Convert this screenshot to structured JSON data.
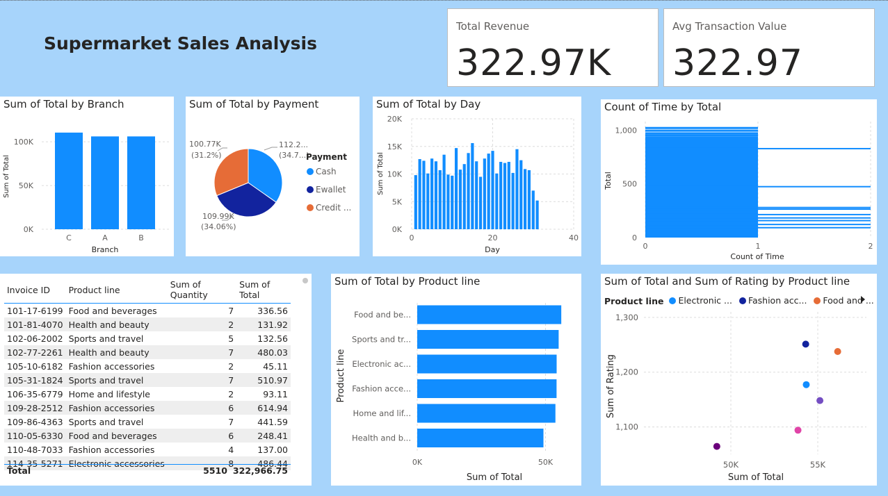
{
  "page": {
    "title": "Supermarket Sales Analysis"
  },
  "cards": [
    {
      "label": "Total Revenue",
      "value": "322.97K"
    },
    {
      "label": "Avg Transaction Value",
      "value": "322.97"
    }
  ],
  "colors": {
    "primary": "#118DFF",
    "navy": "#12239E",
    "orange": "#E66C37",
    "purple": "#6B007B",
    "pink": "#E044A7",
    "violet": "#744EC2"
  },
  "chart_data": [
    {
      "id": "branch",
      "type": "bar",
      "title": "Sum of Total by Branch",
      "categories": [
        "C",
        "A",
        "B"
      ],
      "values": [
        110568.71,
        106200.37,
        106197.67
      ],
      "xlabel": "Branch",
      "ylabel": "Sum of Total",
      "yticks": [
        "0K",
        "50K",
        "100K"
      ],
      "ylim": [
        0,
        120000
      ]
    },
    {
      "id": "payment",
      "type": "pie",
      "title": "Sum of Total by Payment",
      "legend_title": "Payment",
      "slices": [
        {
          "name": "Cash",
          "value": 112206.57,
          "label": "112.2...",
          "pct": "(34.7...)"
        },
        {
          "name": "Ewallet",
          "value": 109993.11,
          "label": "109.99K",
          "pct": "(34.06%)"
        },
        {
          "name": "Credit ...",
          "value": 100767.07,
          "label": "100.77K",
          "pct": "(31.2%)"
        }
      ]
    },
    {
      "id": "day",
      "type": "bar",
      "title": "Sum of Total by Day",
      "x": [
        1,
        2,
        3,
        4,
        5,
        6,
        7,
        8,
        9,
        10,
        11,
        12,
        13,
        14,
        15,
        16,
        17,
        18,
        19,
        20,
        21,
        22,
        23,
        24,
        25,
        26,
        27,
        28,
        29,
        30,
        31
      ],
      "values": [
        9800,
        12700,
        12400,
        10100,
        12800,
        12300,
        10700,
        13500,
        9900,
        9700,
        14700,
        10800,
        11800,
        13800,
        15600,
        12300,
        9500,
        12800,
        13700,
        14200,
        10100,
        12200,
        12000,
        12200,
        10200,
        14500,
        12500,
        10900,
        10700,
        7000,
        5200
      ],
      "xlabel": "Day",
      "ylabel": "Sum of Total",
      "xticks": [
        "0",
        "20",
        "40"
      ],
      "xlim": [
        0,
        40
      ],
      "yticks": [
        "0K",
        "5K",
        "10K",
        "15K",
        "20K"
      ],
      "ylim": [
        0,
        20000
      ]
    },
    {
      "id": "time",
      "type": "bar",
      "title": "Count of Time by Total",
      "xlabel": "Count of Time",
      "ylabel": "Total",
      "xticks": [
        "0",
        "1",
        "2"
      ],
      "xlim": [
        0,
        2
      ],
      "yticks": [
        "0",
        "500",
        "1,000"
      ],
      "ylim": [
        0,
        1080
      ],
      "long_bars": [
        828,
        474,
        280,
        265,
        214,
        183,
        158,
        122,
        92
      ]
    },
    {
      "id": "productline",
      "type": "bar",
      "orientation": "horizontal",
      "title": "Sum of Total by Product line",
      "categories": [
        "Food and be...",
        "Sports and tr...",
        "Electronic ac...",
        "Fashion acce...",
        "Home and lif...",
        "Health and b..."
      ],
      "values": [
        56144.84,
        55122.83,
        54337.53,
        54305.9,
        53861.91,
        49193.74
      ],
      "xlabel": "Sum of Total",
      "ylabel": "Product line",
      "xticks": [
        "0K",
        "50K"
      ],
      "xlim": [
        0,
        58000
      ]
    },
    {
      "id": "rating",
      "type": "scatter",
      "title": "Sum of Total and Sum of Rating by Product line",
      "legend_title": "Product line",
      "legend": [
        "Electronic ...",
        "Fashion acc...",
        "Food and ..."
      ],
      "points": [
        {
          "name": "Electronic accessories",
          "x": 54337.53,
          "y": 1177.2,
          "color": "#118DFF"
        },
        {
          "name": "Fashion accessories",
          "x": 54305.9,
          "y": 1251.2,
          "color": "#12239E"
        },
        {
          "name": "Food and beverages",
          "x": 56144.84,
          "y": 1237.7,
          "color": "#E66C37"
        },
        {
          "name": "Health and beauty",
          "x": 49193.74,
          "y": 1064.5,
          "color": "#6B007B"
        },
        {
          "name": "Home and lifestyle",
          "x": 53861.91,
          "y": 1094.0,
          "color": "#E044A7"
        },
        {
          "name": "Sports and travel",
          "x": 55122.83,
          "y": 1148.1,
          "color": "#744EC2"
        }
      ],
      "xlabel": "Sum of Total",
      "ylabel": "Sum of Rating",
      "xticks": [
        "50K",
        "55K"
      ],
      "xlim": [
        45000,
        57800
      ],
      "yticks": [
        "1,100",
        "1,200",
        "1,300"
      ],
      "ylim": [
        1050,
        1310
      ]
    }
  ],
  "table": {
    "headers": [
      "Invoice ID",
      "Product line",
      "Sum of Quantity",
      "Sum of Total"
    ],
    "rows": [
      [
        "101-17-6199",
        "Food and beverages",
        "7",
        "336.56"
      ],
      [
        "101-81-4070",
        "Health and beauty",
        "2",
        "131.92"
      ],
      [
        "102-06-2002",
        "Sports and travel",
        "5",
        "132.56"
      ],
      [
        "102-77-2261",
        "Health and beauty",
        "7",
        "480.03"
      ],
      [
        "105-10-6182",
        "Fashion accessories",
        "2",
        "45.11"
      ],
      [
        "105-31-1824",
        "Sports and travel",
        "7",
        "510.97"
      ],
      [
        "106-35-6779",
        "Home and lifestyle",
        "2",
        "93.11"
      ],
      [
        "109-28-2512",
        "Fashion accessories",
        "6",
        "614.94"
      ],
      [
        "109-86-4363",
        "Sports and travel",
        "7",
        "441.59"
      ],
      [
        "110-05-6330",
        "Food and beverages",
        "6",
        "248.41"
      ],
      [
        "110-48-7033",
        "Fashion accessories",
        "4",
        "137.00"
      ],
      [
        "114-35-5271",
        "Electronic accessories",
        "8",
        "486.44"
      ]
    ],
    "total": {
      "label": "Total",
      "quantity": "5510",
      "total": "322,966.75"
    }
  }
}
